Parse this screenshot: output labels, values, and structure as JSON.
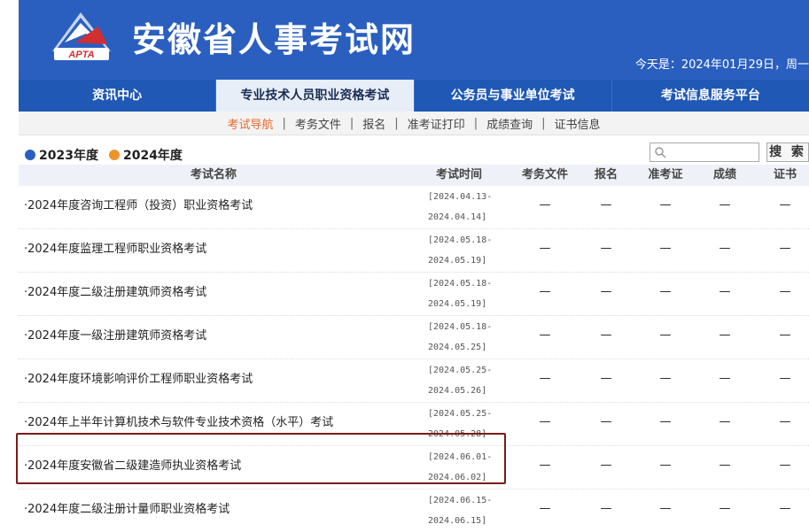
{
  "header": {
    "title": "安徽省人事考试网",
    "logo_text": "APTA",
    "date_text": "今天是：2024年01月29日，周一"
  },
  "main_nav": [
    {
      "label": "资讯中心",
      "active": false
    },
    {
      "label": "专业技术人员职业资格考试",
      "active": true
    },
    {
      "label": "公务员与事业单位考试",
      "active": false
    },
    {
      "label": "考试信息服务平台",
      "active": false
    }
  ],
  "sub_nav": [
    {
      "label": "考试导航",
      "active": true
    },
    {
      "label": "考务文件",
      "active": false
    },
    {
      "label": "报名",
      "active": false
    },
    {
      "label": "准考证打印",
      "active": false
    },
    {
      "label": "成绩查询",
      "active": false
    },
    {
      "label": "证书信息",
      "active": false
    }
  ],
  "years": [
    {
      "label": "2023年度",
      "color": "#2a5fc0"
    },
    {
      "label": "2024年度",
      "color": "#f0922a"
    }
  ],
  "search": {
    "placeholder": "",
    "button": "搜 索"
  },
  "table": {
    "headers": [
      "考试名称",
      "考试时间",
      "考务文件",
      "报名",
      "准考证",
      "成绩",
      "证书"
    ],
    "rows": [
      {
        "name": "·2024年度咨询工程师（投资）职业资格考试",
        "time_start": "[2024.04.13-",
        "time_end": "2024.04.14]",
        "docs": "—",
        "signup": "—",
        "ticket": "—",
        "score": "—",
        "cert": "—"
      },
      {
        "name": "·2024年度监理工程师职业资格考试",
        "time_start": "[2024.05.18-",
        "time_end": "2024.05.19]",
        "docs": "—",
        "signup": "—",
        "ticket": "—",
        "score": "—",
        "cert": "—"
      },
      {
        "name": "·2024年度二级注册建筑师资格考试",
        "time_start": "[2024.05.18-",
        "time_end": "2024.05.19]",
        "docs": "—",
        "signup": "—",
        "ticket": "—",
        "score": "—",
        "cert": "—"
      },
      {
        "name": "·2024年度一级注册建筑师资格考试",
        "time_start": "[2024.05.18-",
        "time_end": "2024.05.25]",
        "docs": "—",
        "signup": "—",
        "ticket": "—",
        "score": "—",
        "cert": "—"
      },
      {
        "name": "·2024年度环境影响评价工程师职业资格考试",
        "time_start": "[2024.05.25-",
        "time_end": "2024.05.26]",
        "docs": "—",
        "signup": "—",
        "ticket": "—",
        "score": "—",
        "cert": "—"
      },
      {
        "name": "·2024年上半年计算机技术与软件专业技术资格（水平）考试",
        "time_start": "[2024.05.25-",
        "time_end": "2024.05.28]",
        "docs": "—",
        "signup": "—",
        "ticket": "—",
        "score": "—",
        "cert": "—"
      },
      {
        "name": "·2024年度安徽省二级建造师执业资格考试",
        "time_start": "[2024.06.01-",
        "time_end": "2024.06.02]",
        "docs": "—",
        "signup": "—",
        "ticket": "—",
        "score": "—",
        "cert": "—"
      },
      {
        "name": "·2024年度二级注册计量师职业资格考试",
        "time_start": "[2024.06.15-",
        "time_end": "2024.06.15]",
        "docs": "—",
        "signup": "—",
        "ticket": "—",
        "score": "—",
        "cert": "—"
      }
    ]
  }
}
